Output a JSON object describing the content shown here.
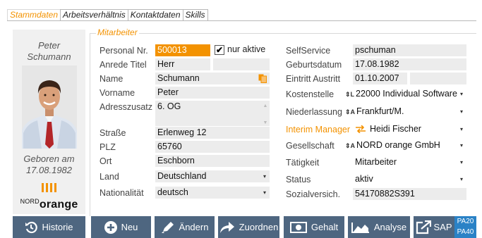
{
  "tabs": [
    "Stammdaten",
    "Arbeitsverhältnis",
    "Kontaktdaten",
    "Skills"
  ],
  "person": {
    "first_name": "Peter",
    "last_name": "Schumann",
    "born_label": "Geboren am",
    "born_date": "17.08.1982",
    "logo_sup": "NORD",
    "logo_main": "orange"
  },
  "legend": "Mitarbeiter",
  "fields": {
    "personal_nr": {
      "label": "Personal Nr.",
      "value": "500013"
    },
    "nur_aktive": {
      "label": "nur aktive",
      "checked": true,
      "mark": "✔"
    },
    "anrede": {
      "label": "Anrede Titel",
      "value": "Herr"
    },
    "name": {
      "label": "Name",
      "value": "Schumann"
    },
    "vorname": {
      "label": "Vorname",
      "value": "Peter"
    },
    "adresszusatz": {
      "label": "Adresszusatz",
      "value": "6. OG"
    },
    "strasse": {
      "label": "Straße",
      "value": "Erlenweg 12"
    },
    "plz": {
      "label": "PLZ",
      "value": "65760"
    },
    "ort": {
      "label": "Ort",
      "value": "Eschborn"
    },
    "land": {
      "label": "Land",
      "value": "Deutschland"
    },
    "nationalitaet": {
      "label": "Nationalität",
      "value": "deutsch"
    },
    "selfservice": {
      "label": "SelfService",
      "value": "pschuman"
    },
    "geburtsdatum": {
      "label": "Geburtsdatum",
      "value": "17.08.1982"
    },
    "eintritt": {
      "label": "Eintritt Austritt",
      "value": "01.10.2007",
      "value2": ""
    },
    "kostenstelle": {
      "label": "Kostenstelle",
      "prefix": "⇕L",
      "value": "22000 Individual Software"
    },
    "niederlassung": {
      "label": "Niederlassung",
      "prefix": "⇕A",
      "value": "Frankfurt/M."
    },
    "interim": {
      "label": "Interim Manager",
      "value": "Heidi Fischer"
    },
    "gesellschaft": {
      "label": "Gesellschaft",
      "prefix": "⇕A",
      "value": "NORD orange GmbH"
    },
    "taetigkeit": {
      "label": "Tätigkeit",
      "value": "Mitarbeiter"
    },
    "status": {
      "label": "Status",
      "value": "aktiv"
    },
    "sozialversich": {
      "label": "Sozialversich.",
      "value": "54170882S391"
    }
  },
  "toolbar": {
    "historie": "Historie",
    "neu": "Neu",
    "aendern": "Ändern",
    "zuordnen": "Zuordnen",
    "gehalt": "Gehalt",
    "analyse": "Analyse",
    "sap": "SAP",
    "pa20": "PA20",
    "pa40": "PA40"
  },
  "colors": {
    "accent": "#f39200",
    "toolbar": "#4e6680",
    "sap_badge": "#2a82c6",
    "field_bg": "#ececec"
  },
  "icons": {
    "dropdown": "▾",
    "name_action": "copy-icon",
    "interim": "swap-arrows-icon"
  }
}
